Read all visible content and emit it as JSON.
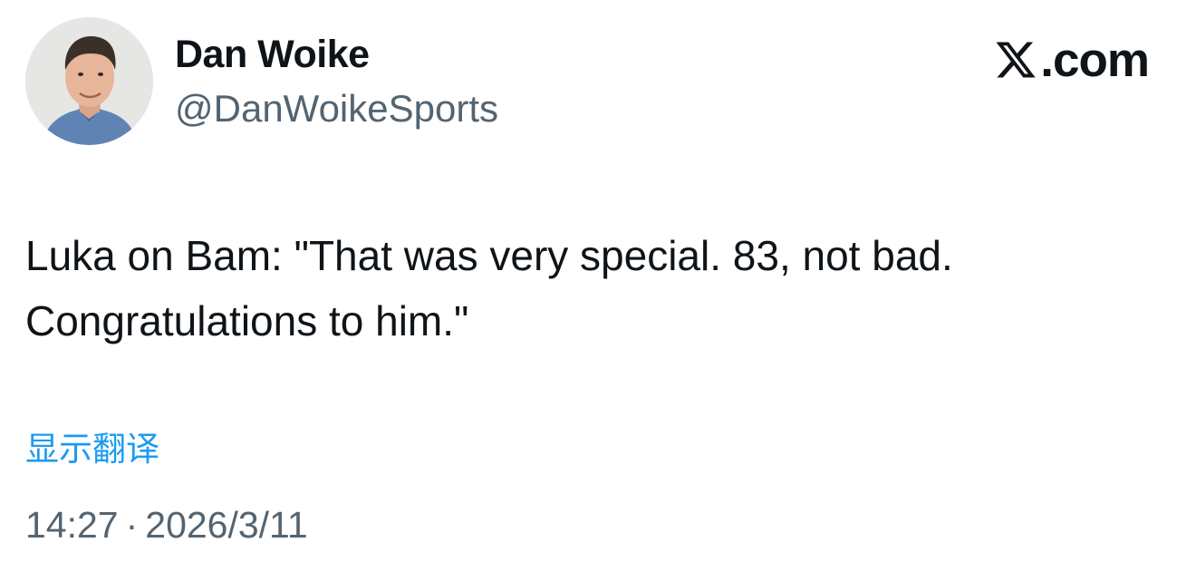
{
  "author": {
    "display_name": "Dan Woike",
    "handle": "@DanWoikeSports",
    "avatar_icon": "person-photo-avatar"
  },
  "brand": {
    "logo_icon": "x-logo-icon",
    "domain": ".com"
  },
  "tweet": {
    "lines": [
      "Luka on Bam: \"That was very special. 83, not bad.",
      "Congratulations to him.\""
    ],
    "translate_label": "显示翻译",
    "time": "14:27",
    "separator": "·",
    "date": "2026/3/11"
  },
  "colors": {
    "text": "#0f1419",
    "secondary": "#536471",
    "link": "#1d9bf0"
  }
}
